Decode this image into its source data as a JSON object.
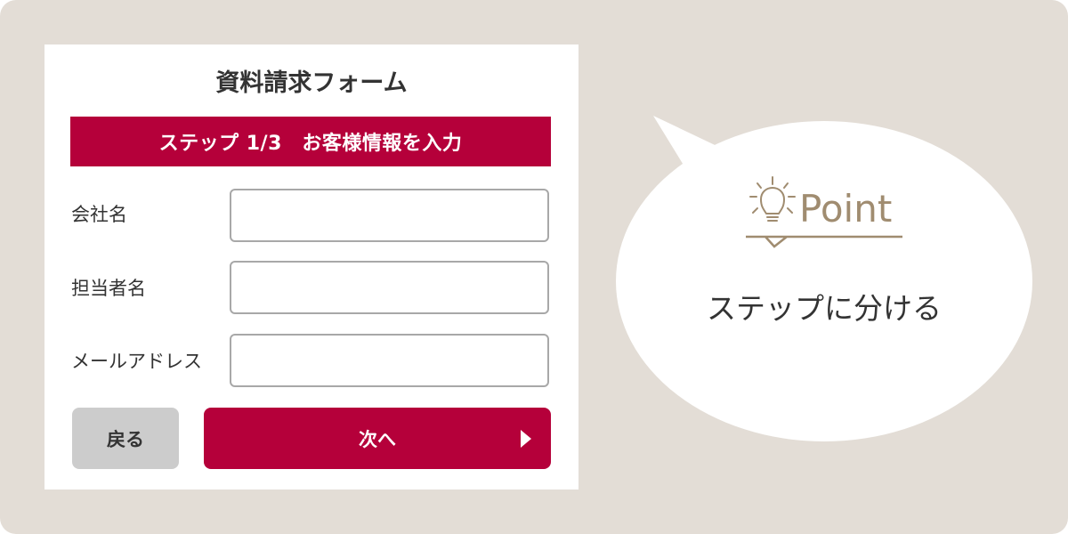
{
  "form": {
    "title": "資料請求フォーム",
    "step_banner": "ステップ 1/3　お客様情報を入力",
    "fields": [
      {
        "label": "会社名",
        "value": ""
      },
      {
        "label": "担当者名",
        "value": ""
      },
      {
        "label": "メールアドレス",
        "value": ""
      }
    ],
    "back_label": "戻る",
    "next_label": "次へ"
  },
  "bubble": {
    "point_label": "Point",
    "message": "ステップに分ける",
    "point_icon": "lightbulb-icon"
  },
  "colors": {
    "background": "#e3ddd6",
    "accent": "#b5003a",
    "point": "#a08c70",
    "back_button": "#cccccc"
  }
}
